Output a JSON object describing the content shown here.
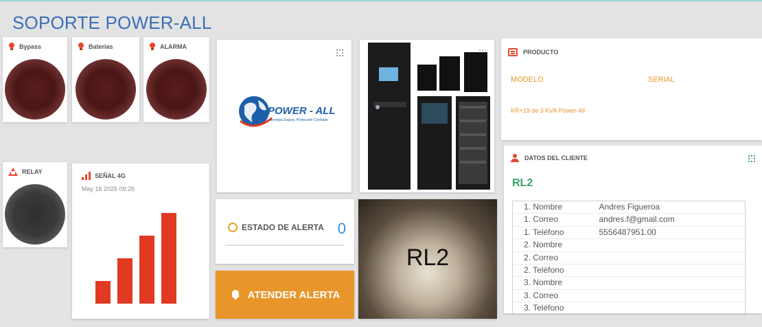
{
  "header": {
    "title": "SOPORTE POWER-ALL"
  },
  "lamps": {
    "bypass": {
      "label": "Bypass",
      "state_color": "#4b1616",
      "icon": "bulb-icon"
    },
    "baterias": {
      "label": "Baterias",
      "state_color": "#4b1616",
      "icon": "bulb-icon"
    },
    "alarma": {
      "label": "ALARMA",
      "state_color": "#4b1616",
      "icon": "bulb-icon"
    },
    "relay": {
      "label": "RELAY",
      "state_color": "#333333",
      "icon": "relay-icon"
    }
  },
  "signal": {
    "label": "SEÑAL 4G",
    "timestamp": "May 16 2025 09:26",
    "icon": "signal-bars-icon",
    "bar_color": "#e03a22",
    "level": 4,
    "levels": 4
  },
  "logo": {
    "text": "POWER - ALL",
    "tagline": "Energía Segura, Protección Confiable",
    "brand_color": "#1d5fa8",
    "accent_color": "#e03a22"
  },
  "alert": {
    "label": "ESTADO DE ALERTA",
    "count": "0",
    "icon": "smile-icon",
    "button_label": "ATENDER ALERTA",
    "button_icon": "bell-icon",
    "button_color": "#e8962a"
  },
  "device_image": {
    "text": "RL2"
  },
  "product": {
    "heading": "PRODUCTO",
    "icon": "product-icon",
    "model_label": "MODELO",
    "serial_label": "SERIAL",
    "value": "KR+19 de 3 KVA Power-All",
    "accent_color": "#e8962a"
  },
  "client": {
    "heading": "DATOS DEL CLIENTE",
    "icon": "person-icon",
    "code": "RL2",
    "code_color": "#3aa36a",
    "rows": [
      {
        "label": "1. Nombre",
        "value": "Andres Figueroa"
      },
      {
        "label": "1. Correo",
        "value": "andres.f@gmail.com"
      },
      {
        "label": "1. Teléfono",
        "value": "5556487951.00"
      },
      {
        "label": "2. Nombre",
        "value": ""
      },
      {
        "label": "2. Correo",
        "value": ""
      },
      {
        "label": "2. Teléfono",
        "value": ""
      },
      {
        "label": "3. Nombre",
        "value": ""
      },
      {
        "label": "3. Correo",
        "value": ""
      },
      {
        "label": "3. Teléfono",
        "value": ""
      }
    ]
  }
}
